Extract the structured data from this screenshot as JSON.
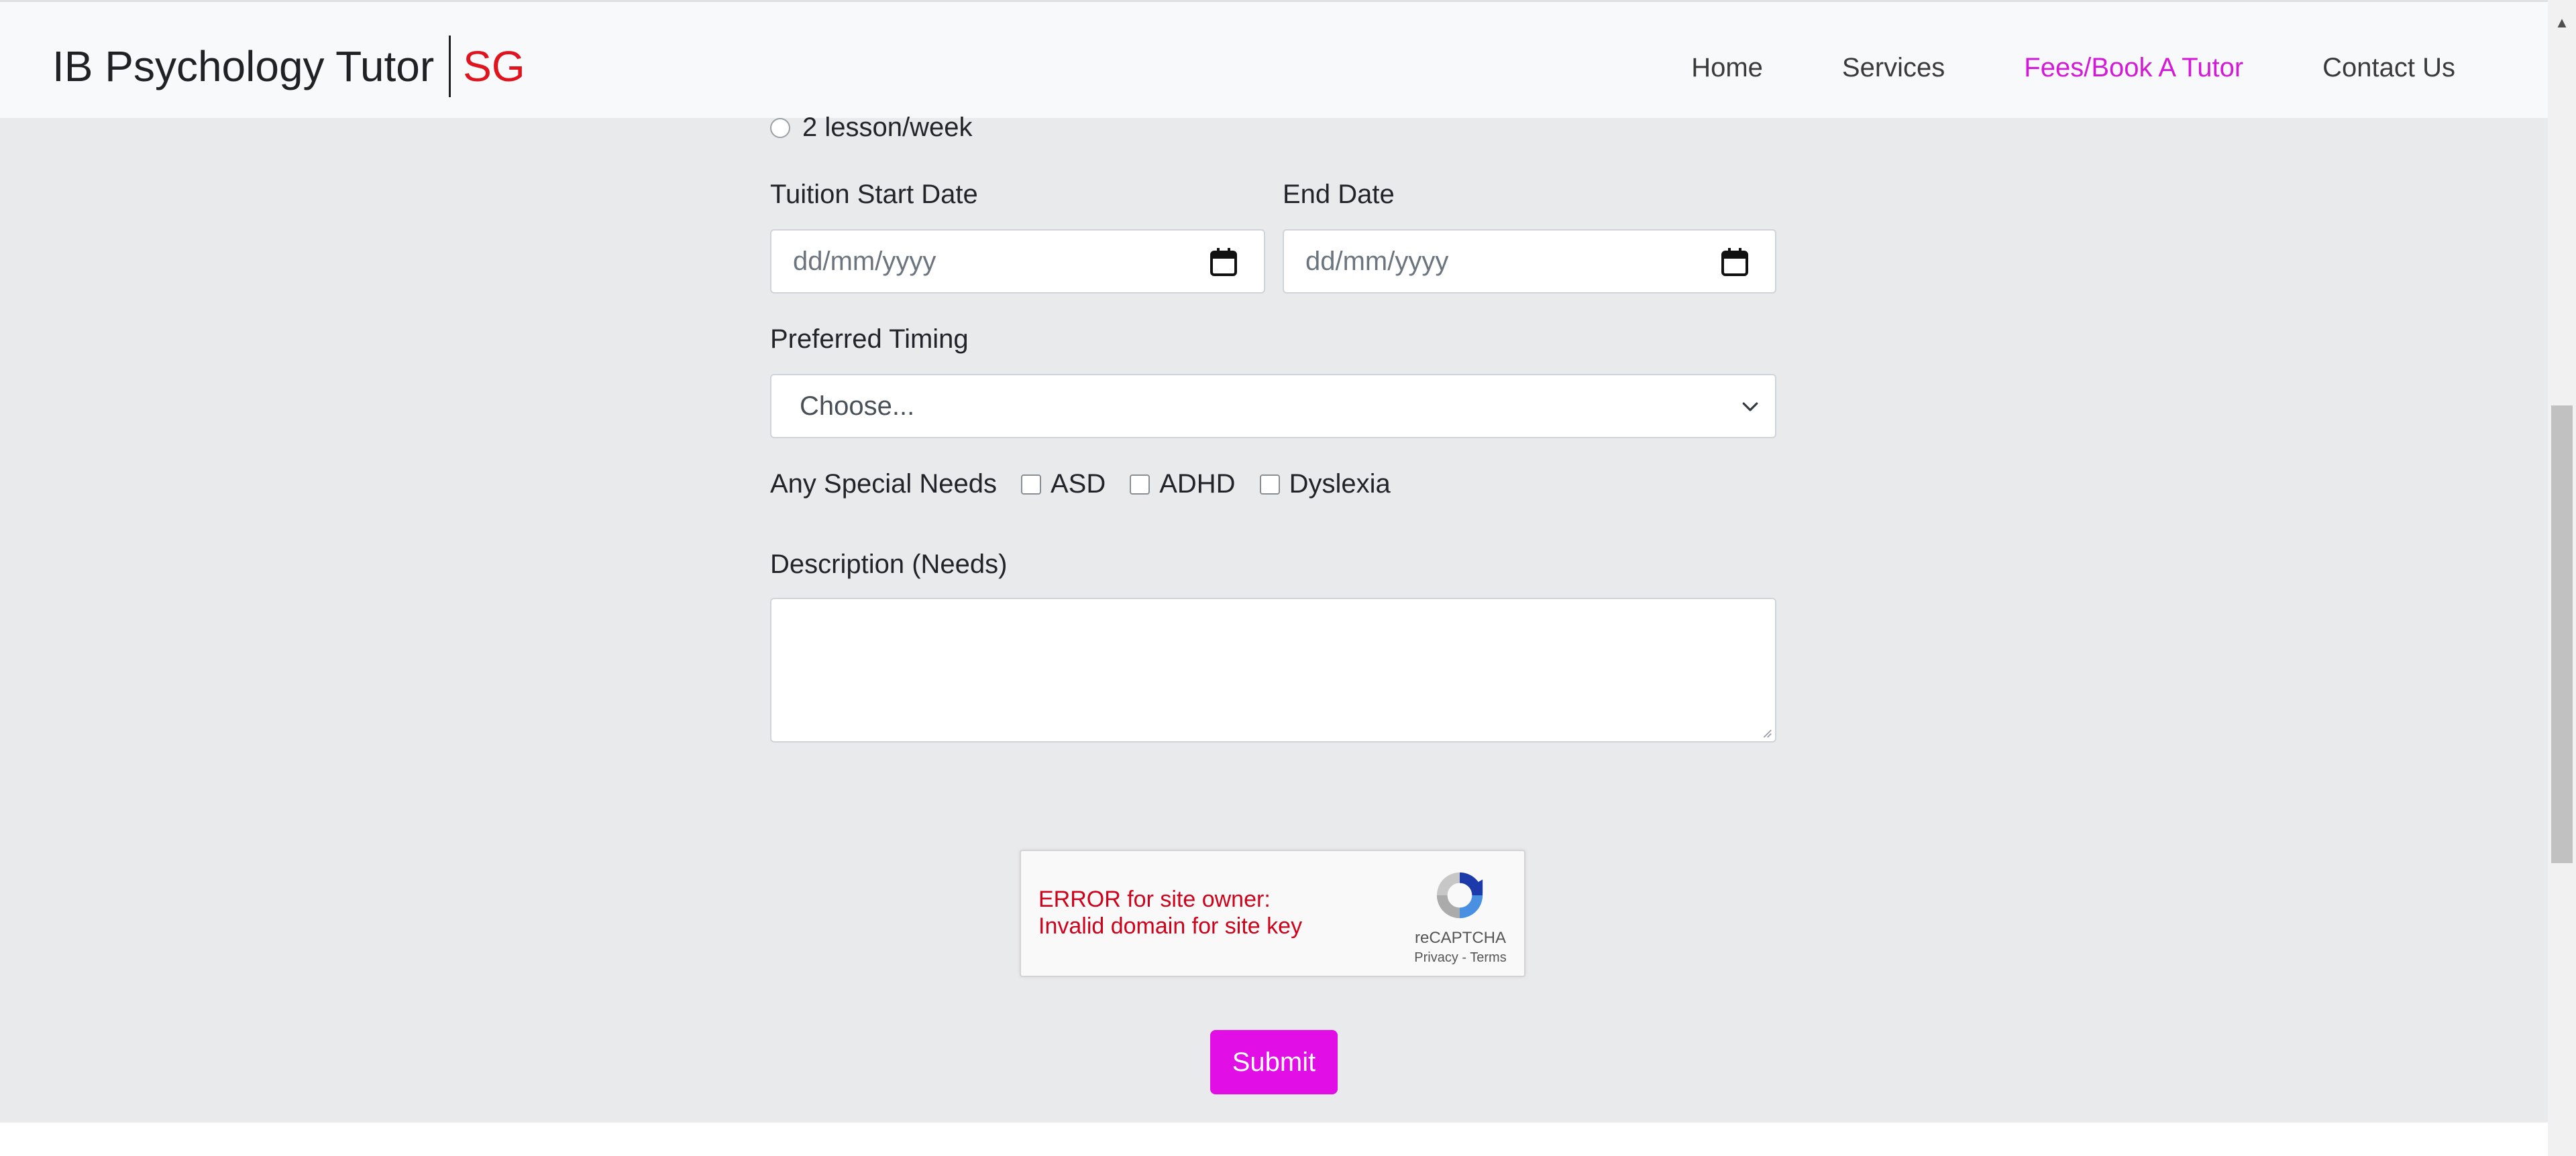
{
  "navbar": {
    "brand_main": "IB Psychology Tutor",
    "brand_suffix": "SG",
    "links": [
      {
        "label": "Home"
      },
      {
        "label": "Services"
      },
      {
        "label": "Fees/Book A Tutor",
        "active": true
      },
      {
        "label": "Contact Us"
      }
    ]
  },
  "form": {
    "frequency_option": "2 lesson/week",
    "start_date_label": "Tuition Start Date",
    "start_date_placeholder": "dd/mm/yyyy",
    "end_date_label": "End Date",
    "end_date_placeholder": "dd/mm/yyyy",
    "timing_label": "Preferred Timing",
    "timing_value": "Choose...",
    "special_needs_label": "Any Special Needs",
    "special_needs_options": [
      "ASD",
      "ADHD",
      "Dyslexia"
    ],
    "description_label": "Description (Needs)",
    "description_value": "",
    "submit_label": "Submit"
  },
  "recaptcha": {
    "error_line1": "ERROR for site owner:",
    "error_line2": "Invalid domain for site key",
    "brand": "reCAPTCHA",
    "links": "Privacy - Terms"
  },
  "colors": {
    "accent": "#e10ee6",
    "active_link": "#d31ad8",
    "brand_suffix": "#e0141e",
    "error": "#d0021b",
    "page_background": "#e9eaec"
  },
  "icons": {
    "date_picker": "calendar-icon",
    "select": "chevron-down-icon",
    "recaptcha": "recaptcha-logo-icon",
    "scroll": "scroll-up-arrow-icon"
  }
}
